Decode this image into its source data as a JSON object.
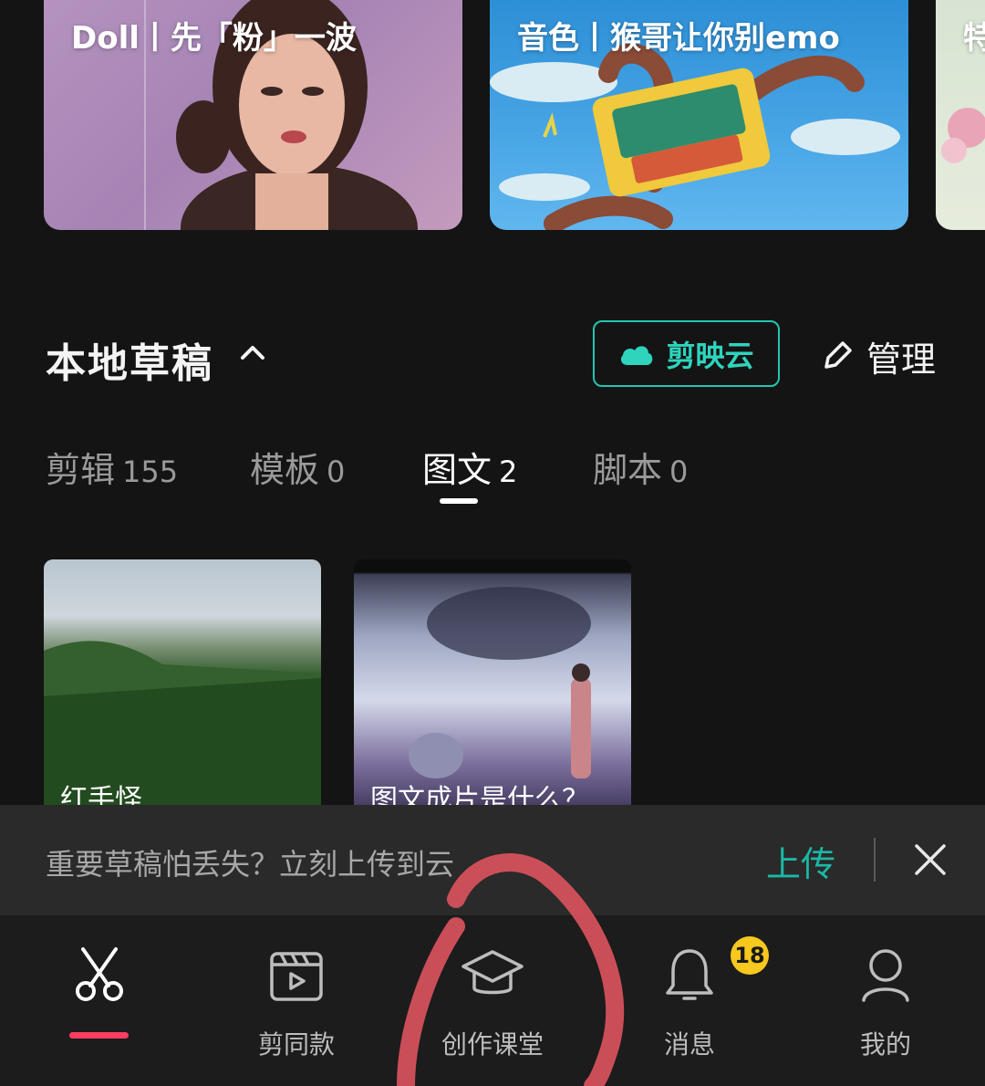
{
  "banners": [
    {
      "title": "Doll丨先「粉」一波"
    },
    {
      "title": "音色丨猴哥让你别emo"
    },
    {
      "title": "特"
    }
  ],
  "section": {
    "title": "本地草稿",
    "cloud_button": "剪映云",
    "manage_button": "管理"
  },
  "tabs": [
    {
      "label": "剪辑",
      "count": "155"
    },
    {
      "label": "模板",
      "count": "0"
    },
    {
      "label": "图文",
      "count": "2"
    },
    {
      "label": "脚本",
      "count": "0"
    }
  ],
  "drafts": [
    {
      "caption": "红手怪"
    },
    {
      "caption": "图文成片是什么？"
    }
  ],
  "upload_prompt": {
    "text": "重要草稿怕丢失？立刻上传到云",
    "action": "上传"
  },
  "nav": [
    {
      "label": "",
      "icon": "scissors-icon"
    },
    {
      "label": "剪同款",
      "icon": "clapperboard-icon"
    },
    {
      "label": "创作课堂",
      "icon": "graduation-cap-icon"
    },
    {
      "label": "消息",
      "icon": "bell-icon",
      "badge": "18"
    },
    {
      "label": "我的",
      "icon": "person-icon"
    }
  ],
  "colors": {
    "accent_teal": "#23c5b1",
    "active_tab_bar": "#ff3d63",
    "badge": "#f7c81d",
    "annotation": "#d9535d"
  }
}
